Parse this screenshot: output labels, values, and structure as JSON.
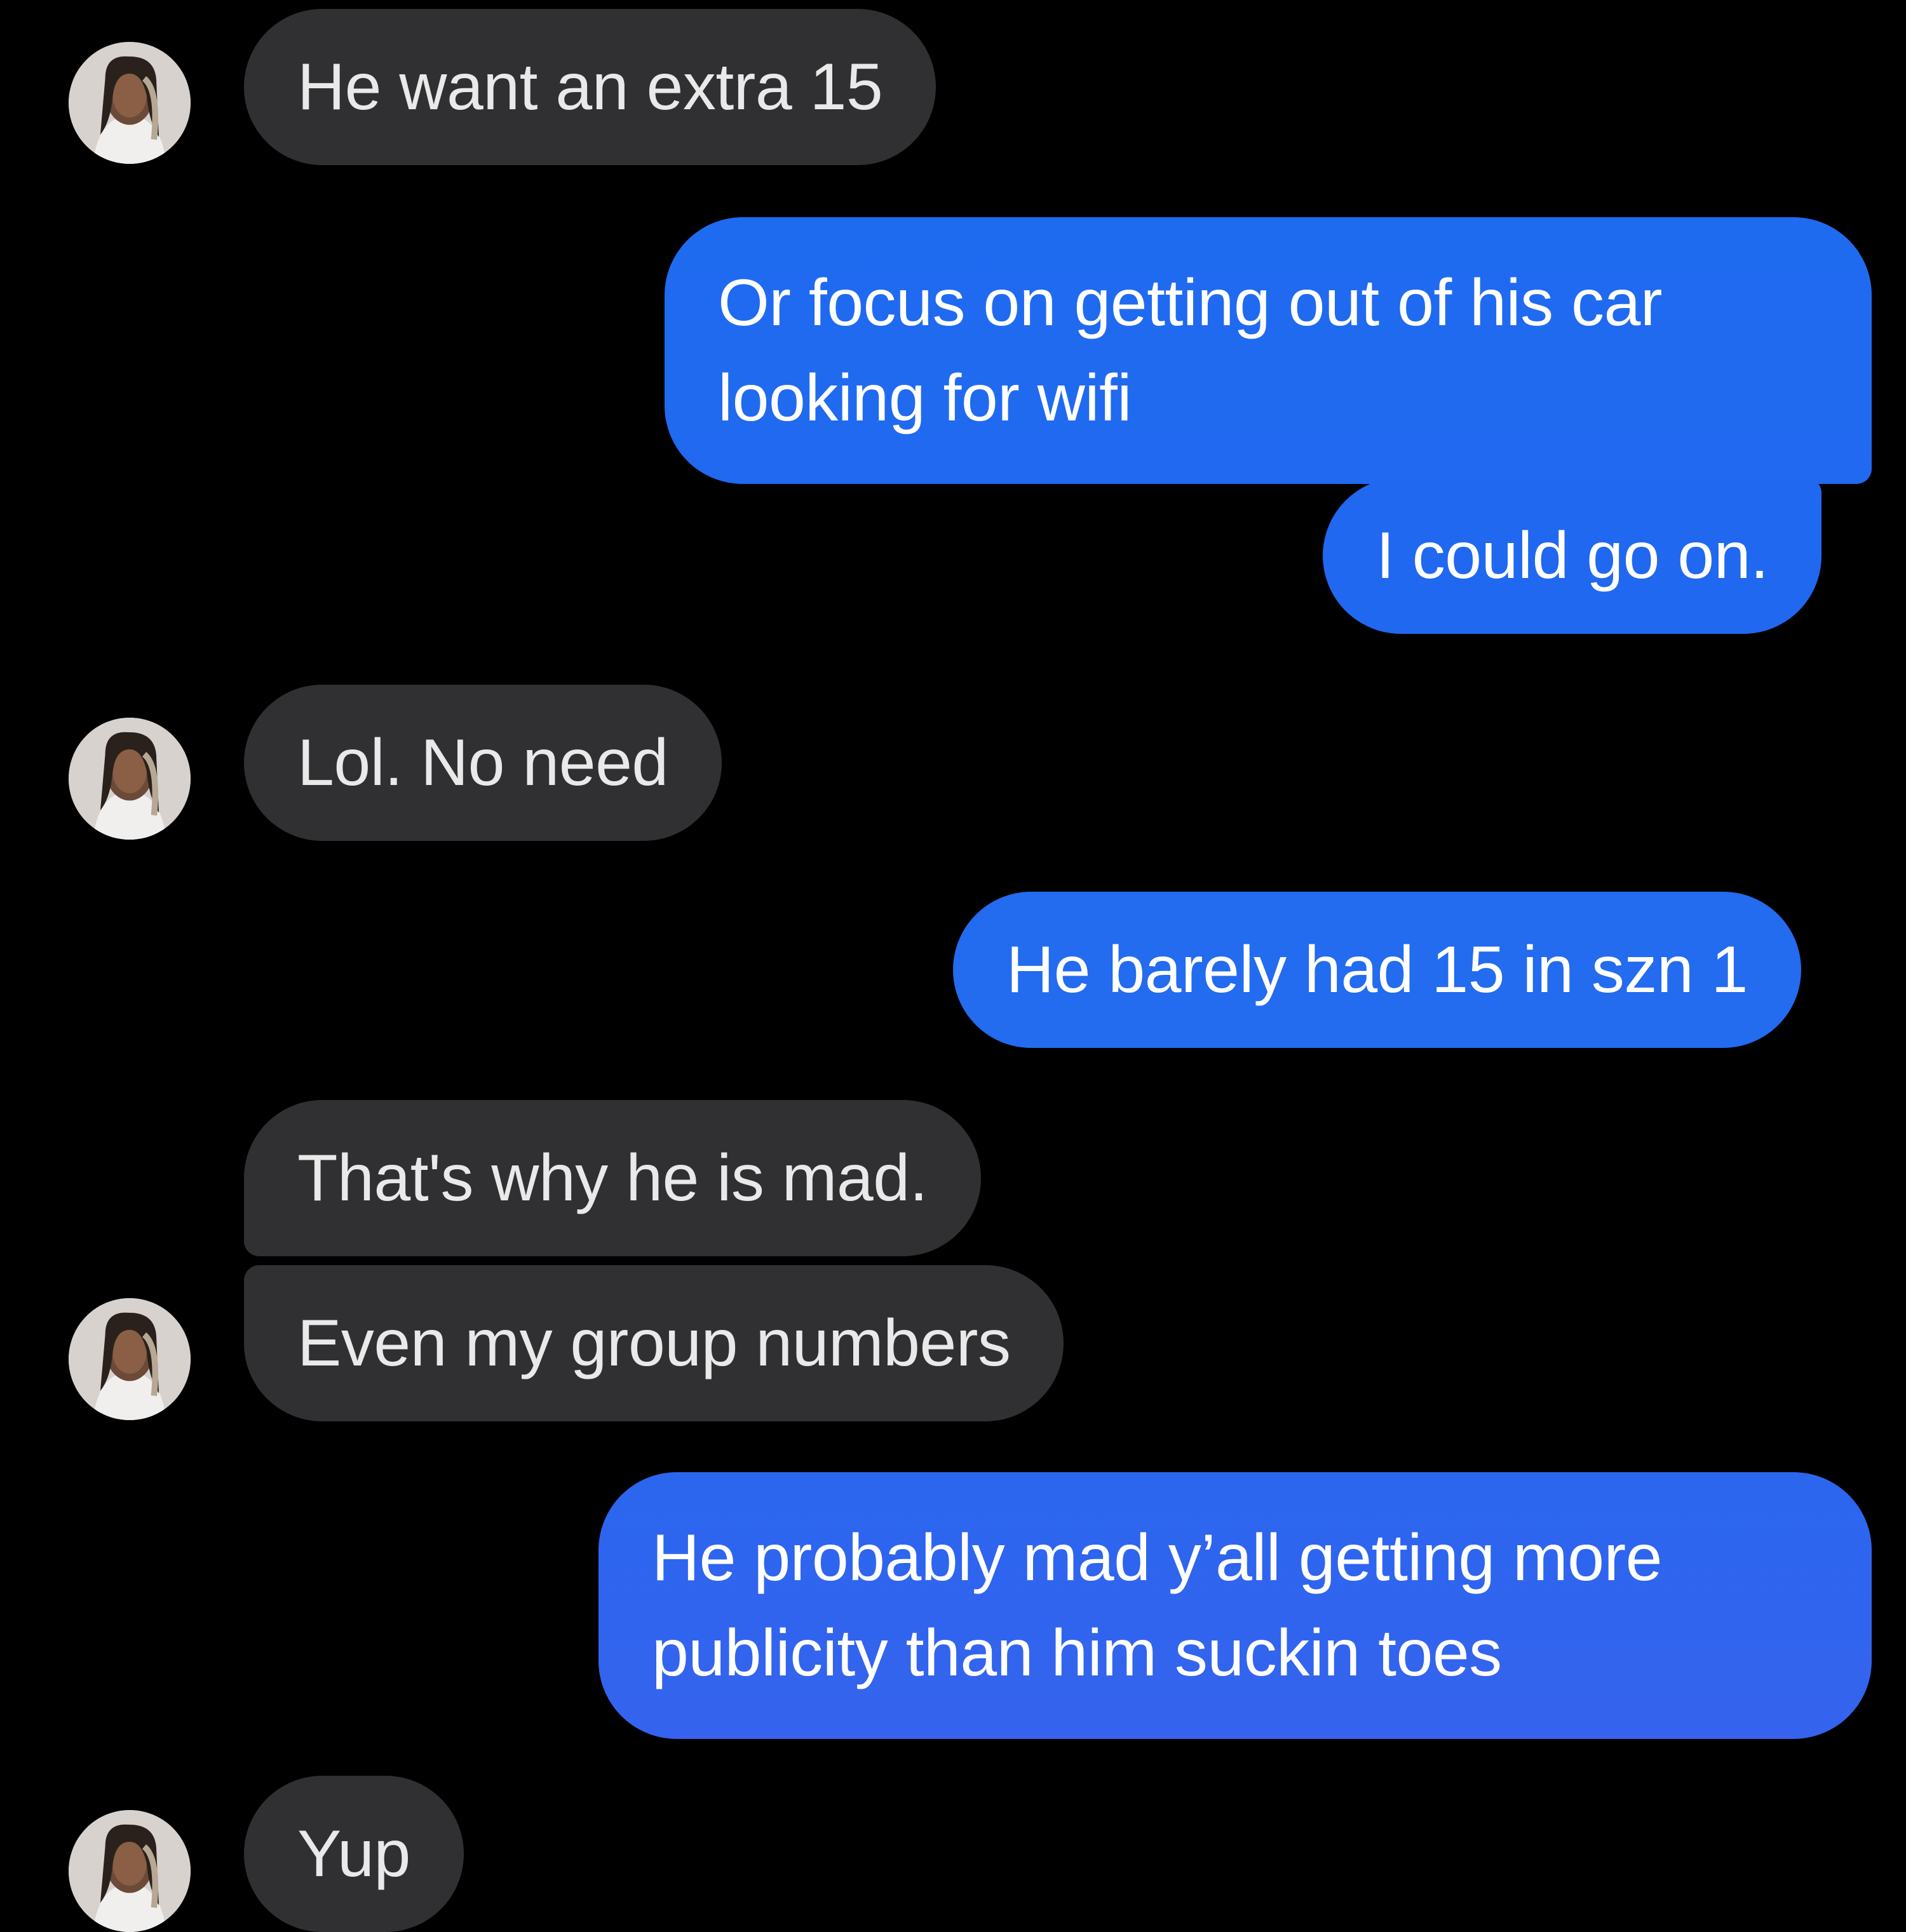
{
  "messages": [
    {
      "id": "m1",
      "direction": "incoming",
      "text": "He want an extra 15",
      "avatar": "contact-avatar"
    },
    {
      "id": "m2",
      "direction": "outgoing",
      "text": "Or focus on getting out of his car looking for wifi"
    },
    {
      "id": "m3",
      "direction": "outgoing",
      "text": "I could go on."
    },
    {
      "id": "m4",
      "direction": "incoming",
      "text": "Lol. No need",
      "avatar": "contact-avatar"
    },
    {
      "id": "m5",
      "direction": "outgoing",
      "text": "He barely had 15 in szn 1"
    },
    {
      "id": "m6",
      "direction": "incoming",
      "text": "That's why he is mad."
    },
    {
      "id": "m7",
      "direction": "incoming",
      "text": "Even my group numbers",
      "avatar": "contact-avatar"
    },
    {
      "id": "m8",
      "direction": "outgoing",
      "text": "He probably mad y’all getting more publicity than him suckin toes"
    },
    {
      "id": "m9",
      "direction": "incoming",
      "text": "Yup",
      "avatar": "contact-avatar"
    }
  ],
  "colors": {
    "background": "#000000",
    "incoming_bubble": "#303032",
    "incoming_text": "#e9e9ea",
    "outgoing_bubble_top": "#1f6bf0",
    "outgoing_bubble_bottom": "#3563ee",
    "outgoing_text": "#ffffff"
  }
}
